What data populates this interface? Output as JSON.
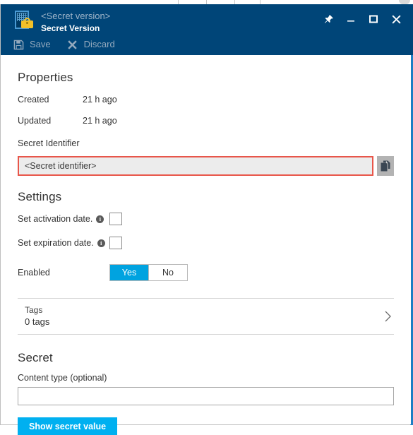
{
  "window": {
    "title_sub": "<Secret version>",
    "title_main": "Secret Version",
    "icon": "secret-lock-icon",
    "controls": [
      {
        "name": "pin-icon",
        "label": "Pin"
      },
      {
        "name": "minimize-icon",
        "label": "Minimize"
      },
      {
        "name": "maximize-icon",
        "label": "Maximize"
      },
      {
        "name": "close-icon",
        "label": "Close"
      }
    ]
  },
  "commandbar": {
    "save_label": "Save",
    "discard_label": "Discard"
  },
  "properties": {
    "heading": "Properties",
    "rows": [
      {
        "label": "Created",
        "value": "21 h ago"
      },
      {
        "label": "Updated",
        "value": "21 h ago"
      }
    ],
    "identifier_label": "Secret Identifier",
    "identifier_value": "<Secret identifier>",
    "copy_button_label": "Copy"
  },
  "settings": {
    "heading": "Settings",
    "activation_label": "Set activation date.",
    "expiration_label": "Set expiration date.",
    "activation_checked": false,
    "expiration_checked": false,
    "enabled_label": "Enabled",
    "enabled_options": [
      "Yes",
      "No"
    ],
    "enabled_selected": "Yes"
  },
  "tags": {
    "title": "Tags",
    "count_text": "0 tags"
  },
  "secret": {
    "heading": "Secret",
    "content_type_label": "Content type (optional)",
    "content_type_value": "",
    "content_type_placeholder": "",
    "show_button_label": "Show secret value"
  },
  "colors": {
    "header_blue": "#004578",
    "accent_blue": "#00b0f0",
    "toggle_blue": "#00a3e0",
    "error_red": "#e8564a",
    "edge_blue": "#1d7ec4",
    "lock_gold": "#f2c029"
  }
}
